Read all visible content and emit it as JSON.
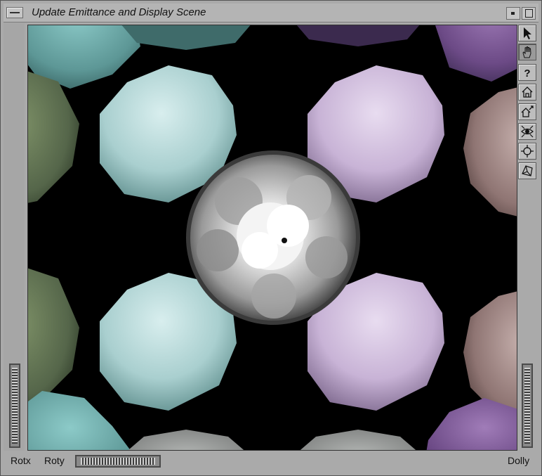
{
  "window": {
    "title": "Update Emittance and Display Scene"
  },
  "toolbar": {
    "tools": [
      {
        "name": "pick-arrow-icon",
        "active": false
      },
      {
        "name": "hand-icon",
        "active": true
      },
      {
        "name": "help-icon",
        "active": false
      },
      {
        "name": "home-icon",
        "active": false
      },
      {
        "name": "set-home-icon",
        "active": false
      },
      {
        "name": "view-all-icon",
        "active": false
      },
      {
        "name": "seek-icon",
        "active": false
      },
      {
        "name": "perspective-icon",
        "active": false
      }
    ]
  },
  "bottom": {
    "rotx_label": "Rotx",
    "roty_label": "Roty",
    "dolly_label": "Dolly"
  },
  "colors": {
    "background": "#000000",
    "teal": "#7fb9b8",
    "cyan_light": "#cfe6e6",
    "lavender": "#cdbad8",
    "purple": "#7d5a93",
    "olive": "#5d6e4e",
    "rose": "#a48e8b",
    "gray": "#8c8e8d"
  }
}
